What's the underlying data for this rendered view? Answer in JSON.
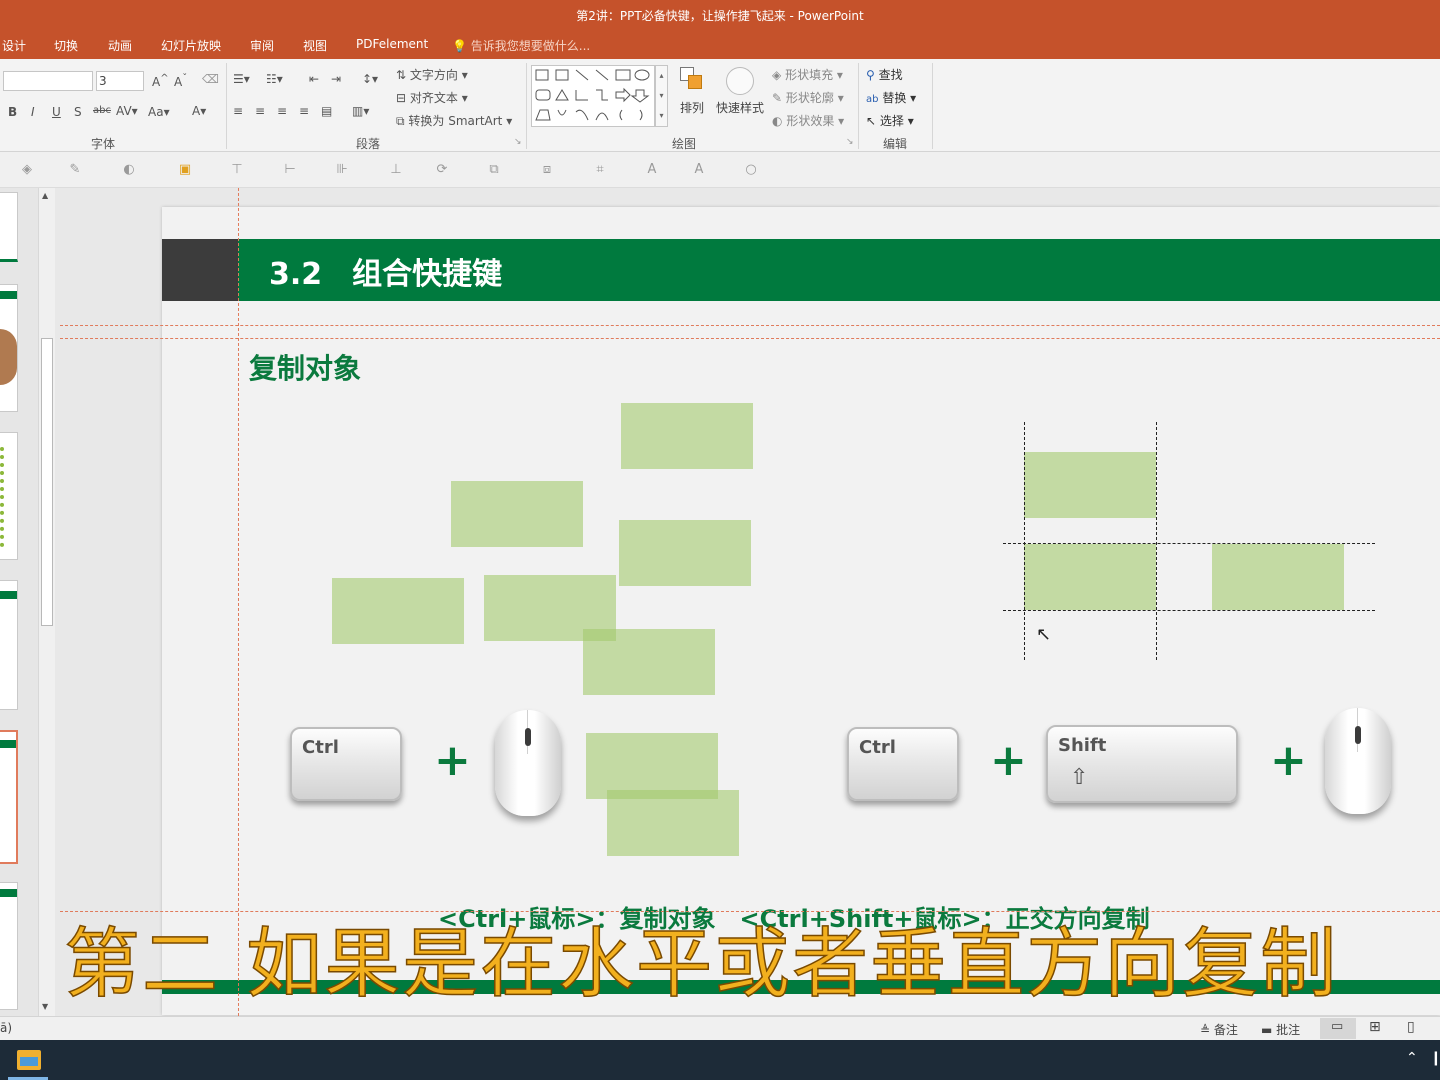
{
  "window": {
    "title": "第2讲：PPT必备快键，让操作捷飞起来 - PowerPoint"
  },
  "menu": {
    "items": [
      "设计",
      "切换",
      "动画",
      "幻灯片放映",
      "审阅",
      "视图",
      "PDFelement"
    ],
    "tellme": "告诉我您想要做什么..."
  },
  "ribbon": {
    "font_size_value": "3",
    "group_font": "字体",
    "group_paragraph": "段落",
    "group_drawing": "绘图",
    "group_edit": "编辑",
    "text_direction": "文字方向",
    "align_text": "对齐文本",
    "convert_smartart": "转换为 SmartArt",
    "arrange": "排列",
    "quick_styles": "快速样式",
    "shape_fill": "形状填充",
    "shape_outline": "形状轮廓",
    "shape_effects": "形状效果",
    "find": "查找",
    "replace": "替换",
    "select": "选择"
  },
  "slide": {
    "header_title": "3.2　组合快捷键",
    "subtitle": "复制对象",
    "key_ctrl": "Ctrl",
    "key_shift": "Shift",
    "plus": "+",
    "caption": "<Ctrl+鼠标>：复制对象　<Ctrl+Shift+鼠标>：正交方向复制",
    "colors": {
      "brand_green": "#007a3e",
      "box_green": "#a3c96e",
      "header_dark": "#3c3c3c"
    }
  },
  "overlay_subtitle": "第二 如果是在水平或者垂直方向复制",
  "statusbar": {
    "left_fragment": "ā)",
    "notes": "备注",
    "comments": "批注"
  }
}
